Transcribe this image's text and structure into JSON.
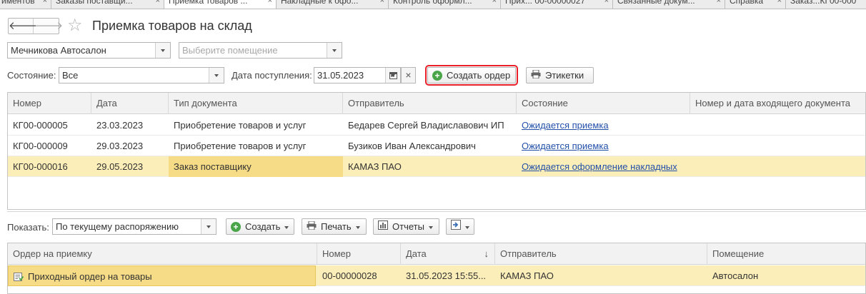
{
  "tabs": [
    {
      "label": "иментов",
      "active": false
    },
    {
      "label": "Заказы поставщи...",
      "active": false
    },
    {
      "label": "Приемка товаров ...",
      "active": true
    },
    {
      "label": "Накладные к офо...",
      "active": false
    },
    {
      "label": "Контроль оформл...",
      "active": false
    },
    {
      "label": "Прих... 00-00000027",
      "active": false
    },
    {
      "label": "Связанные докум...",
      "active": false
    },
    {
      "label": "Справка",
      "active": false
    },
    {
      "label": "Заказ...КГ00-000",
      "active": false
    }
  ],
  "tab_close_glyph": "×",
  "nav": {
    "back_glyph": "🡐",
    "forward_glyph": "🡒"
  },
  "header": {
    "title": "Приемка товаров на склад",
    "favorite_glyph": "☆"
  },
  "filters": {
    "organization_value": "Мечникова Автосалон",
    "room_placeholder": "Выберите помещение",
    "state_label": "Состояние:",
    "state_value": "Все",
    "date_label": "Дата поступления:",
    "date_value": "31.05.2023",
    "clear_glyph": "×"
  },
  "toolbar_top": {
    "create_order_label": "Создать ордер",
    "labels_label": "Этикетки"
  },
  "documents_table": {
    "columns": [
      "Номер",
      "Дата",
      "Тип документа",
      "Отправитель",
      "Состояние",
      "Номер и дата входящего документа"
    ],
    "rows": [
      {
        "number": "КГ00-000005",
        "date": "23.03.2023",
        "type": "Приобретение товаров и услуг",
        "sender": "Бедарев Сергей Владиславович ИП",
        "state": "Ожидается приемка",
        "incoming": ""
      },
      {
        "number": "КГ00-000009",
        "date": "29.03.2023",
        "type": "Приобретение товаров и услуг",
        "sender": "Бузиков Иван Александрович",
        "state": "Ожидается приемка",
        "incoming": ""
      },
      {
        "number": "КГ00-000016",
        "date": "29.05.2023",
        "type": "Заказ поставщику",
        "sender": "КАМАЗ ПАО",
        "state": "Ожидается оформление накладных",
        "incoming": ""
      }
    ]
  },
  "toolbar_bottom": {
    "show_label": "Показать:",
    "show_value": "По текущему распоряжению",
    "create_label": "Создать",
    "print_label": "Печать",
    "reports_label": "Отчеты"
  },
  "orders_table": {
    "columns": [
      "Ордер на приемку",
      "Номер",
      "Дата",
      "Отправитель",
      "Помещение"
    ],
    "sort_glyph": "↓",
    "rows": [
      {
        "order": "Приходный ордер на товары",
        "number": "00-00000028",
        "date": "31.05.2023 15:55...",
        "sender": "КАМАЗ ПАО",
        "room": "Автосалон"
      }
    ]
  },
  "colors": {
    "accent_green": "#4aa54a",
    "link_blue": "#2350a9",
    "selection_yellow": "#fbeeb8",
    "highlight_red": "#e8202a"
  }
}
